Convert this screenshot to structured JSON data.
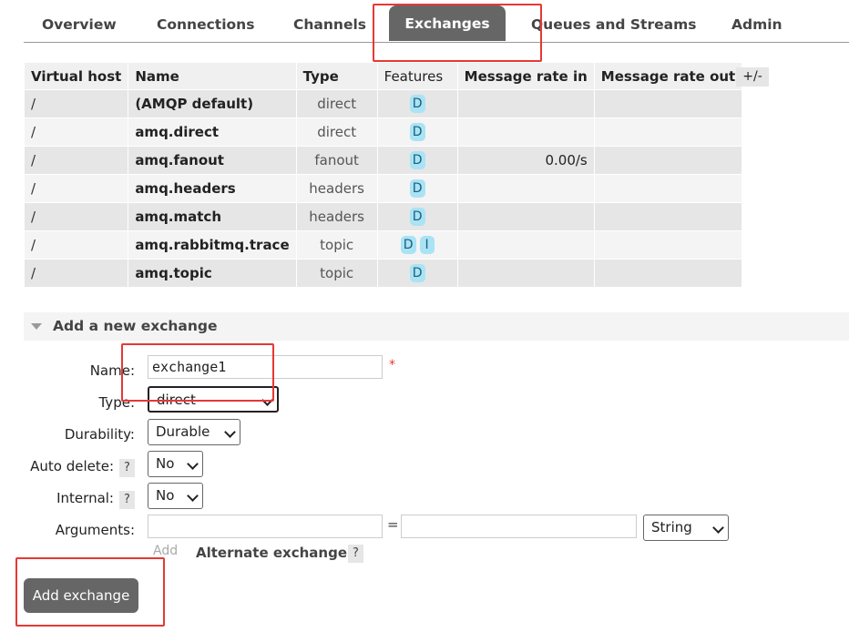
{
  "nav": {
    "tabs": [
      "Overview",
      "Connections",
      "Channels",
      "Exchanges",
      "Queues and Streams",
      "Admin"
    ],
    "active": "Exchanges"
  },
  "table": {
    "headers": [
      "Virtual host",
      "Name",
      "Type",
      "Features",
      "Message rate in",
      "Message rate out"
    ],
    "toggle_columns": "+/-",
    "rows": [
      {
        "vhost": "/",
        "name": "(AMQP default)",
        "type": "direct",
        "features": [
          "D"
        ],
        "rate_in": "",
        "rate_out": ""
      },
      {
        "vhost": "/",
        "name": "amq.direct",
        "type": "direct",
        "features": [
          "D"
        ],
        "rate_in": "",
        "rate_out": ""
      },
      {
        "vhost": "/",
        "name": "amq.fanout",
        "type": "fanout",
        "features": [
          "D"
        ],
        "rate_in": "0.00/s",
        "rate_out": ""
      },
      {
        "vhost": "/",
        "name": "amq.headers",
        "type": "headers",
        "features": [
          "D"
        ],
        "rate_in": "",
        "rate_out": ""
      },
      {
        "vhost": "/",
        "name": "amq.match",
        "type": "headers",
        "features": [
          "D"
        ],
        "rate_in": "",
        "rate_out": ""
      },
      {
        "vhost": "/",
        "name": "amq.rabbitmq.trace",
        "type": "topic",
        "features": [
          "D",
          "I"
        ],
        "rate_in": "",
        "rate_out": ""
      },
      {
        "vhost": "/",
        "name": "amq.topic",
        "type": "topic",
        "features": [
          "D"
        ],
        "rate_in": "",
        "rate_out": ""
      }
    ]
  },
  "add_exchange": {
    "title": "Add a new exchange",
    "name_label": "Name:",
    "name_value": "exchange1",
    "required_mark": "*",
    "type_label": "Type:",
    "type_value": "direct",
    "durability_label": "Durability:",
    "durability_value": "Durable",
    "auto_delete_label": "Auto delete:",
    "auto_delete_value": "No",
    "internal_label": "Internal:",
    "internal_value": "No",
    "arguments_label": "Arguments:",
    "equals": "=",
    "arg_type_value": "String",
    "add_link": "Add",
    "alternate_exchange": "Alternate exchange",
    "help": "?",
    "submit_label": "Add exchange"
  },
  "colors": {
    "highlight": "#e53935",
    "active_tab": "#666666",
    "badge": "#a9e3f5"
  }
}
